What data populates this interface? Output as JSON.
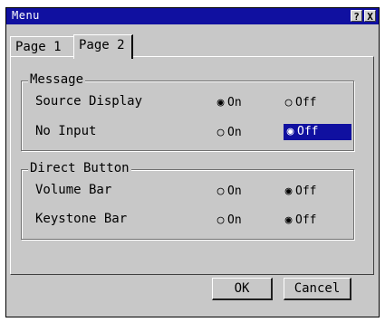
{
  "window": {
    "title": "Menu",
    "help_label": "?",
    "close_label": "X"
  },
  "tabs": [
    {
      "label": "Page 1",
      "active": false
    },
    {
      "label": "Page 2",
      "active": true
    }
  ],
  "message_group": {
    "title": "Message",
    "rows": [
      {
        "label": "Source Display",
        "on_label": "On",
        "off_label": "Off",
        "selected": "On",
        "highlighted": false
      },
      {
        "label": "No Input",
        "on_label": "On",
        "off_label": "Off",
        "selected": "Off",
        "highlighted": true
      }
    ]
  },
  "direct_group": {
    "title": "Direct Button",
    "rows": [
      {
        "label": "Volume Bar",
        "on_label": "On",
        "off_label": "Off",
        "selected": "Off",
        "highlighted": false
      },
      {
        "label": "Keystone Bar",
        "on_label": "On",
        "off_label": "Off",
        "selected": "Off",
        "highlighted": false
      }
    ]
  },
  "buttons": {
    "ok_label": "OK",
    "cancel_label": "Cancel"
  },
  "colors": {
    "titlebar": "#1010a0",
    "highlight": "#1010a0",
    "face": "#c8c8c8"
  }
}
